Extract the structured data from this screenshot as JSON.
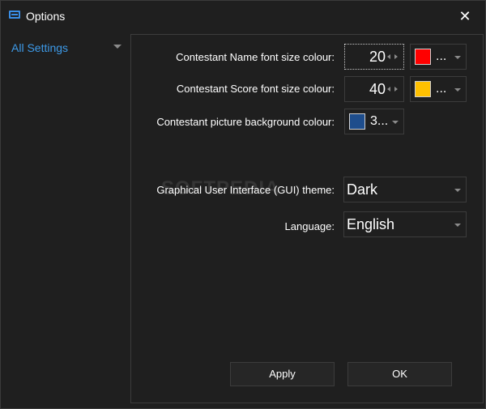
{
  "window": {
    "title": "Options",
    "close_label": "✕"
  },
  "sidebar": {
    "items": [
      {
        "label": "All Settings",
        "selected": true
      }
    ]
  },
  "settings": {
    "name_font": {
      "label": "Contestant Name font size  colour:",
      "size": "20",
      "colour": "#ff0000",
      "colour_text": "..."
    },
    "score_font": {
      "label": "Contestant Score font size  colour:",
      "size": "40",
      "colour": "#ffc000",
      "colour_text": "..."
    },
    "picture_bg": {
      "label": "Contestant picture background colour:",
      "colour": "#1e4d8c",
      "colour_text": "3..."
    },
    "theme": {
      "label": "Graphical User Interface (GUI) theme:",
      "value": "Dark"
    },
    "language": {
      "label": "Language:",
      "value": "English"
    }
  },
  "buttons": {
    "apply": "Apply",
    "ok": "OK"
  },
  "watermark": "SOFTPEDIA"
}
